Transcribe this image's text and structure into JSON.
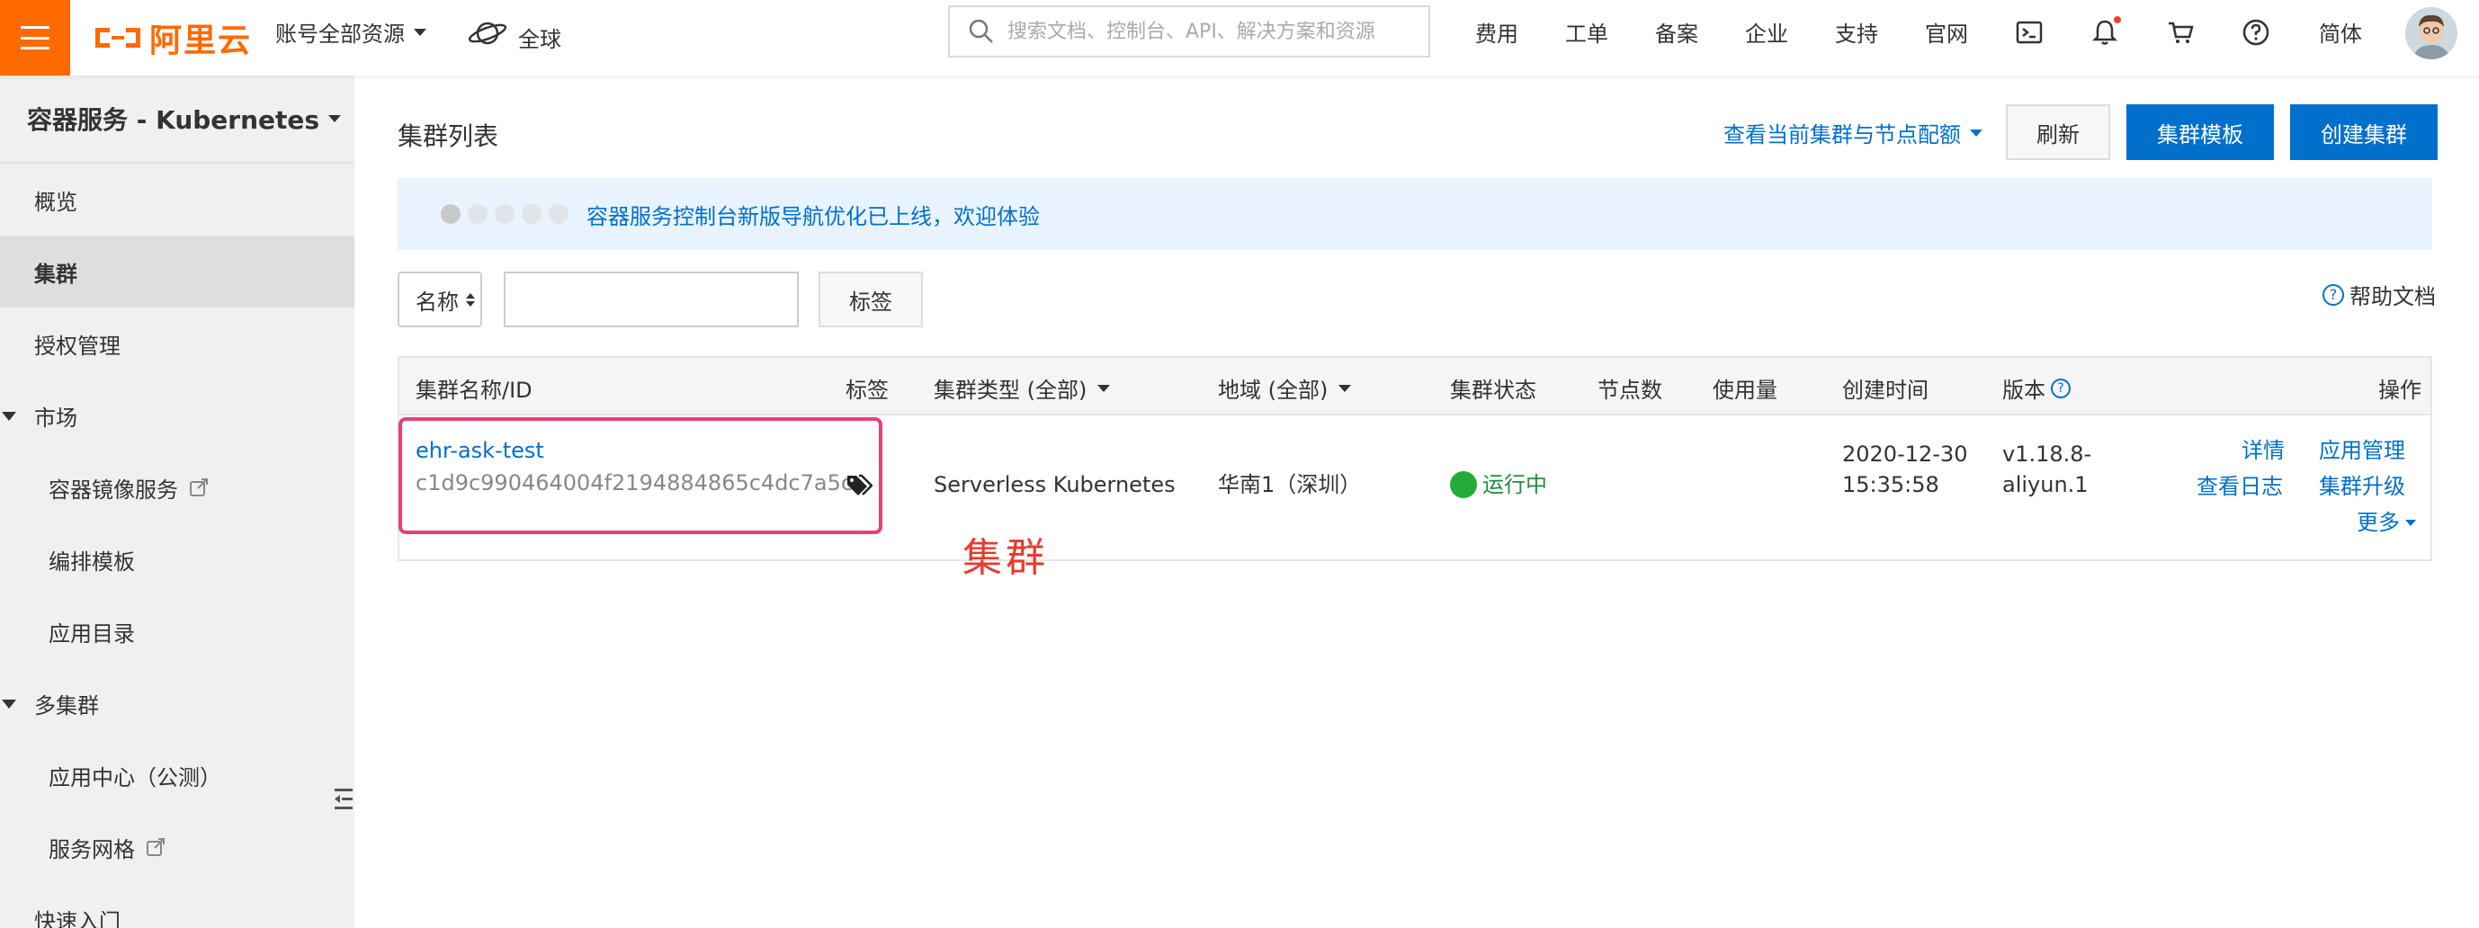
{
  "topbar": {
    "logo_text": "阿里云",
    "account_scope": "账号全部资源",
    "region": "全球",
    "search_placeholder": "搜索文档、控制台、API、解决方案和资源",
    "nav": [
      "费用",
      "工单",
      "备案",
      "企业",
      "支持",
      "官网"
    ],
    "language": "简体",
    "icons": [
      "terminal-icon",
      "bell-icon",
      "cart-icon",
      "help-icon"
    ],
    "brand_color": "#ff6a00"
  },
  "sidebar": {
    "title": "容器服务 - Kubernetes",
    "items": [
      {
        "label": "概览"
      },
      {
        "label": "集群"
      },
      {
        "label": "授权管理"
      },
      {
        "label": "市场"
      },
      {
        "label": "容器镜像服务"
      },
      {
        "label": "编排模板"
      },
      {
        "label": "应用目录"
      },
      {
        "label": "多集群"
      },
      {
        "label": "应用中心（公测）"
      },
      {
        "label": "服务网格"
      },
      {
        "label": "快速入门"
      }
    ]
  },
  "main": {
    "title": "集群列表",
    "quota_link": "查看当前集群与节点配额",
    "buttons": {
      "refresh": "刷新",
      "template": "集群模板",
      "create": "创建集群"
    },
    "notice": "容器服务控制台新版导航优化已上线，欢迎体验",
    "filter": {
      "select_value": "名称",
      "input_value": "",
      "tag_button": "标签"
    },
    "help_link": "帮助文档",
    "table": {
      "headers": {
        "name": "集群名称/ID",
        "tags": "标签",
        "type": "集群类型 (全部)",
        "region": "地域 (全部)",
        "status": "集群状态",
        "nodes": "节点数",
        "usage": "使用量",
        "created": "创建时间",
        "version": "版本",
        "actions": "操作"
      },
      "rows": [
        {
          "name": "ehr-ask-test",
          "id": "c1d9c990464004f2194884865c4dc7a5c",
          "type": "Serverless Kubernetes",
          "region": "华南1（深圳）",
          "status": "运行中",
          "created_date": "2020-12-30",
          "created_time": "15:35:58",
          "version_line1": "v1.18.8-",
          "version_line2": "aliyun.1",
          "actions": {
            "details": "详情",
            "app_manage": "应用管理",
            "logs": "查看日志",
            "upgrade": "集群升级",
            "more": "更多"
          }
        }
      ]
    },
    "annotation": "集群",
    "colors": {
      "link": "#0070cc",
      "status_ok": "#22ab38",
      "highlight": "#e8407a",
      "annotation": "#e63b2e"
    }
  }
}
